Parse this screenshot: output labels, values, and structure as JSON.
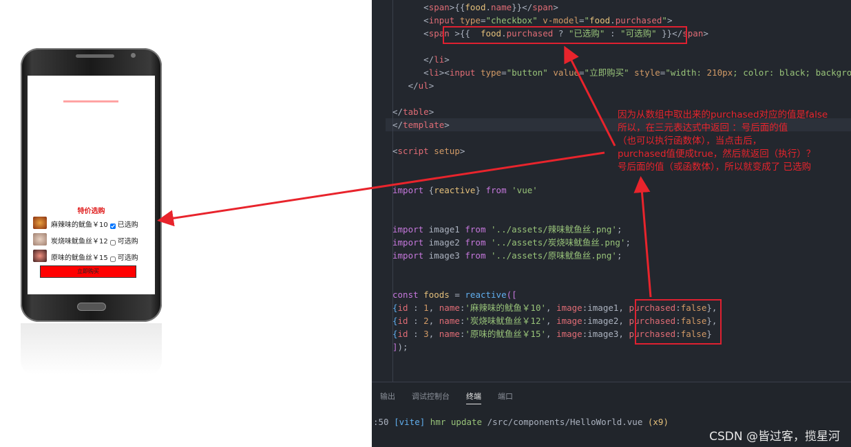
{
  "phone": {
    "section_title": "特价选购",
    "foods": [
      {
        "name": "麻辣味的鱿鱼￥10",
        "purchased": true,
        "status": "已选购"
      },
      {
        "name": "炭烧味鱿鱼丝￥12",
        "purchased": false,
        "status": "可选购"
      },
      {
        "name": "原味的鱿鱼丝￥15",
        "purchased": false,
        "status": "可选购"
      }
    ],
    "buy_label": "立即购买"
  },
  "code": [
    {
      "indent": "      ",
      "tokens": [
        [
          "<",
          "p"
        ],
        [
          "span",
          "tag"
        ],
        [
          ">{{",
          "p"
        ],
        [
          "food",
          "var"
        ],
        [
          ".",
          "p"
        ],
        [
          "name",
          "prop"
        ],
        [
          "}}</",
          "p"
        ],
        [
          "span",
          "tag"
        ],
        [
          ">",
          "p"
        ]
      ]
    },
    {
      "indent": "      ",
      "tokens": [
        [
          "<",
          "p"
        ],
        [
          "input",
          "tag"
        ],
        [
          " ",
          "p"
        ],
        [
          "type",
          "attr"
        ],
        [
          "=",
          "p"
        ],
        [
          "\"checkbox\"",
          "str"
        ],
        [
          " ",
          "p"
        ],
        [
          "v-model",
          "attr"
        ],
        [
          "=",
          "p"
        ],
        [
          "\"",
          "str"
        ],
        [
          "food",
          "var"
        ],
        [
          ".",
          "p"
        ],
        [
          "purchased",
          "prop"
        ],
        [
          "\"",
          "str"
        ],
        [
          ">",
          "p"
        ]
      ]
    },
    {
      "indent": "      ",
      "tokens": [
        [
          "<",
          "p"
        ],
        [
          "span",
          "tag"
        ],
        [
          " >{{  ",
          "p"
        ],
        [
          "food",
          "var"
        ],
        [
          ".",
          "p"
        ],
        [
          "purchased",
          "prop"
        ],
        [
          " ? ",
          "p"
        ],
        [
          "\"已选购\"",
          "str"
        ],
        [
          " : ",
          "p"
        ],
        [
          "\"可选购\"",
          "str"
        ],
        [
          " }}</",
          "p"
        ],
        [
          "span",
          "tag"
        ],
        [
          ">",
          "p"
        ]
      ]
    },
    {
      "indent": "",
      "tokens": []
    },
    {
      "indent": "      ",
      "tokens": [
        [
          "</",
          "p"
        ],
        [
          "li",
          "tag"
        ],
        [
          ">",
          "p"
        ]
      ]
    },
    {
      "indent": "      ",
      "tokens": [
        [
          "<",
          "p"
        ],
        [
          "li",
          "tag"
        ],
        [
          "><",
          "p"
        ],
        [
          "input",
          "tag"
        ],
        [
          " ",
          "p"
        ],
        [
          "type",
          "attr"
        ],
        [
          "=",
          "p"
        ],
        [
          "\"button\"",
          "str"
        ],
        [
          " ",
          "p"
        ],
        [
          "value",
          "attr"
        ],
        [
          "=",
          "p"
        ],
        [
          "\"立即购买\"",
          "str"
        ],
        [
          " ",
          "p"
        ],
        [
          "style",
          "attr"
        ],
        [
          "=",
          "p"
        ],
        [
          "\"width: ",
          "str"
        ],
        [
          "210px",
          "num"
        ],
        [
          "; color: black; backgro",
          "str"
        ]
      ]
    },
    {
      "indent": "   ",
      "tokens": [
        [
          "</",
          "p"
        ],
        [
          "ul",
          "tag"
        ],
        [
          ">",
          "p"
        ]
      ]
    },
    {
      "indent": "",
      "tokens": []
    },
    {
      "indent": "",
      "tokens": [
        [
          "</",
          "p"
        ],
        [
          "table",
          "tag"
        ],
        [
          ">",
          "p"
        ]
      ]
    },
    {
      "indent": "",
      "tokens": [
        [
          "</",
          "p"
        ],
        [
          "template",
          "tag"
        ],
        [
          ">",
          "p"
        ]
      ]
    },
    {
      "indent": "",
      "tokens": []
    },
    {
      "indent": "",
      "tokens": [
        [
          "<",
          "p"
        ],
        [
          "script",
          "tag"
        ],
        [
          " ",
          "p"
        ],
        [
          "setup",
          "attr"
        ],
        [
          ">",
          "p"
        ]
      ]
    },
    {
      "indent": "",
      "tokens": []
    },
    {
      "indent": "",
      "tokens": []
    },
    {
      "indent": "",
      "tokens": [
        [
          "import",
          "kw"
        ],
        [
          " {",
          "p"
        ],
        [
          "reactive",
          "var"
        ],
        [
          "} ",
          "p"
        ],
        [
          "from",
          "kw"
        ],
        [
          " ",
          "p"
        ],
        [
          "'vue'",
          "str"
        ]
      ]
    },
    {
      "indent": "",
      "tokens": []
    },
    {
      "indent": "",
      "tokens": []
    },
    {
      "indent": "",
      "tokens": [
        [
          "import",
          "kw"
        ],
        [
          " image1 ",
          "p"
        ],
        [
          "from",
          "kw"
        ],
        [
          " ",
          "p"
        ],
        [
          "'../assets/辣味鱿鱼丝.png'",
          "str"
        ],
        [
          ";",
          "p"
        ]
      ]
    },
    {
      "indent": "",
      "tokens": [
        [
          "import",
          "kw"
        ],
        [
          " image2 ",
          "p"
        ],
        [
          "from",
          "kw"
        ],
        [
          " ",
          "p"
        ],
        [
          "'../assets/炭烧味鱿鱼丝.png'",
          "str"
        ],
        [
          ";",
          "p"
        ]
      ]
    },
    {
      "indent": "",
      "tokens": [
        [
          "import",
          "kw"
        ],
        [
          " image3 ",
          "p"
        ],
        [
          "from",
          "kw"
        ],
        [
          " ",
          "p"
        ],
        [
          "'../assets/原味鱿鱼丝.png'",
          "str"
        ],
        [
          ";",
          "p"
        ]
      ]
    },
    {
      "indent": "",
      "tokens": []
    },
    {
      "indent": "",
      "tokens": []
    },
    {
      "indent": "",
      "tokens": [
        [
          "const",
          "kw"
        ],
        [
          " ",
          "p"
        ],
        [
          "foods",
          "var"
        ],
        [
          " = ",
          "p"
        ],
        [
          "reactive",
          "fn"
        ],
        [
          "([",
          "kw"
        ]
      ]
    },
    {
      "indent": "",
      "tokens": [
        [
          "{",
          "fn"
        ],
        [
          "id",
          "prop"
        ],
        [
          " : ",
          "p"
        ],
        [
          "1",
          "num"
        ],
        [
          ", ",
          "p"
        ],
        [
          "name",
          "prop"
        ],
        [
          ":",
          "p"
        ],
        [
          "'麻辣味的鱿鱼￥10'",
          "str"
        ],
        [
          ", ",
          "p"
        ],
        [
          "image",
          "prop"
        ],
        [
          ":image1, ",
          "p"
        ],
        [
          "purchased",
          "prop"
        ],
        [
          ":",
          "p"
        ],
        [
          "false",
          "num"
        ],
        [
          "},",
          "p"
        ]
      ]
    },
    {
      "indent": "",
      "tokens": [
        [
          "{",
          "fn"
        ],
        [
          "id",
          "prop"
        ],
        [
          " : ",
          "p"
        ],
        [
          "2",
          "num"
        ],
        [
          ", ",
          "p"
        ],
        [
          "name",
          "prop"
        ],
        [
          ":",
          "p"
        ],
        [
          "'炭烧味鱿鱼丝￥12'",
          "str"
        ],
        [
          ", ",
          "p"
        ],
        [
          "image",
          "prop"
        ],
        [
          ":image2, ",
          "p"
        ],
        [
          "purchased",
          "prop"
        ],
        [
          ":",
          "p"
        ],
        [
          "false",
          "num"
        ],
        [
          "},",
          "p"
        ]
      ]
    },
    {
      "indent": "",
      "tokens": [
        [
          "{",
          "fn"
        ],
        [
          "id",
          "prop"
        ],
        [
          " : ",
          "p"
        ],
        [
          "3",
          "num"
        ],
        [
          ", ",
          "p"
        ],
        [
          "name",
          "prop"
        ],
        [
          ":",
          "p"
        ],
        [
          "'原味的鱿鱼丝￥15'",
          "str"
        ],
        [
          ", ",
          "p"
        ],
        [
          "image",
          "prop"
        ],
        [
          ":image3, ",
          "p"
        ],
        [
          "purchased",
          "prop"
        ],
        [
          ":",
          "p"
        ],
        [
          "false",
          "num"
        ],
        [
          "}",
          "p"
        ]
      ]
    },
    {
      "indent": "",
      "tokens": [
        [
          "]",
          "kw"
        ],
        [
          ");",
          "p"
        ]
      ]
    }
  ],
  "panel": {
    "tabs": [
      "输出",
      "调试控制台",
      "终端",
      "端口"
    ],
    "active_tab": "终端",
    "terminal": [
      [
        ":50 ",
        "p"
      ],
      [
        "[vite]",
        "fn"
      ],
      [
        " hmr update ",
        "str"
      ],
      [
        "/src/components/HelloWorld.vue ",
        "p"
      ],
      [
        "(x9)",
        "var"
      ]
    ]
  },
  "annotation": "因为从数组中取出来的purchased对应的值是false\n所以，在三元表达式中返回 ：号后面的值\n（也可以执行函数体），当点击后，\npurchased值便成true，然后就返回（执行）？\n号后面的值（或函数体），所以就变成了 已选购",
  "watermark": "CSDN @皆过客，揽星河",
  "colors": {
    "annotation": "#e8242c",
    "editor_bg": "#23272e",
    "buy_button": "#ff0000"
  }
}
